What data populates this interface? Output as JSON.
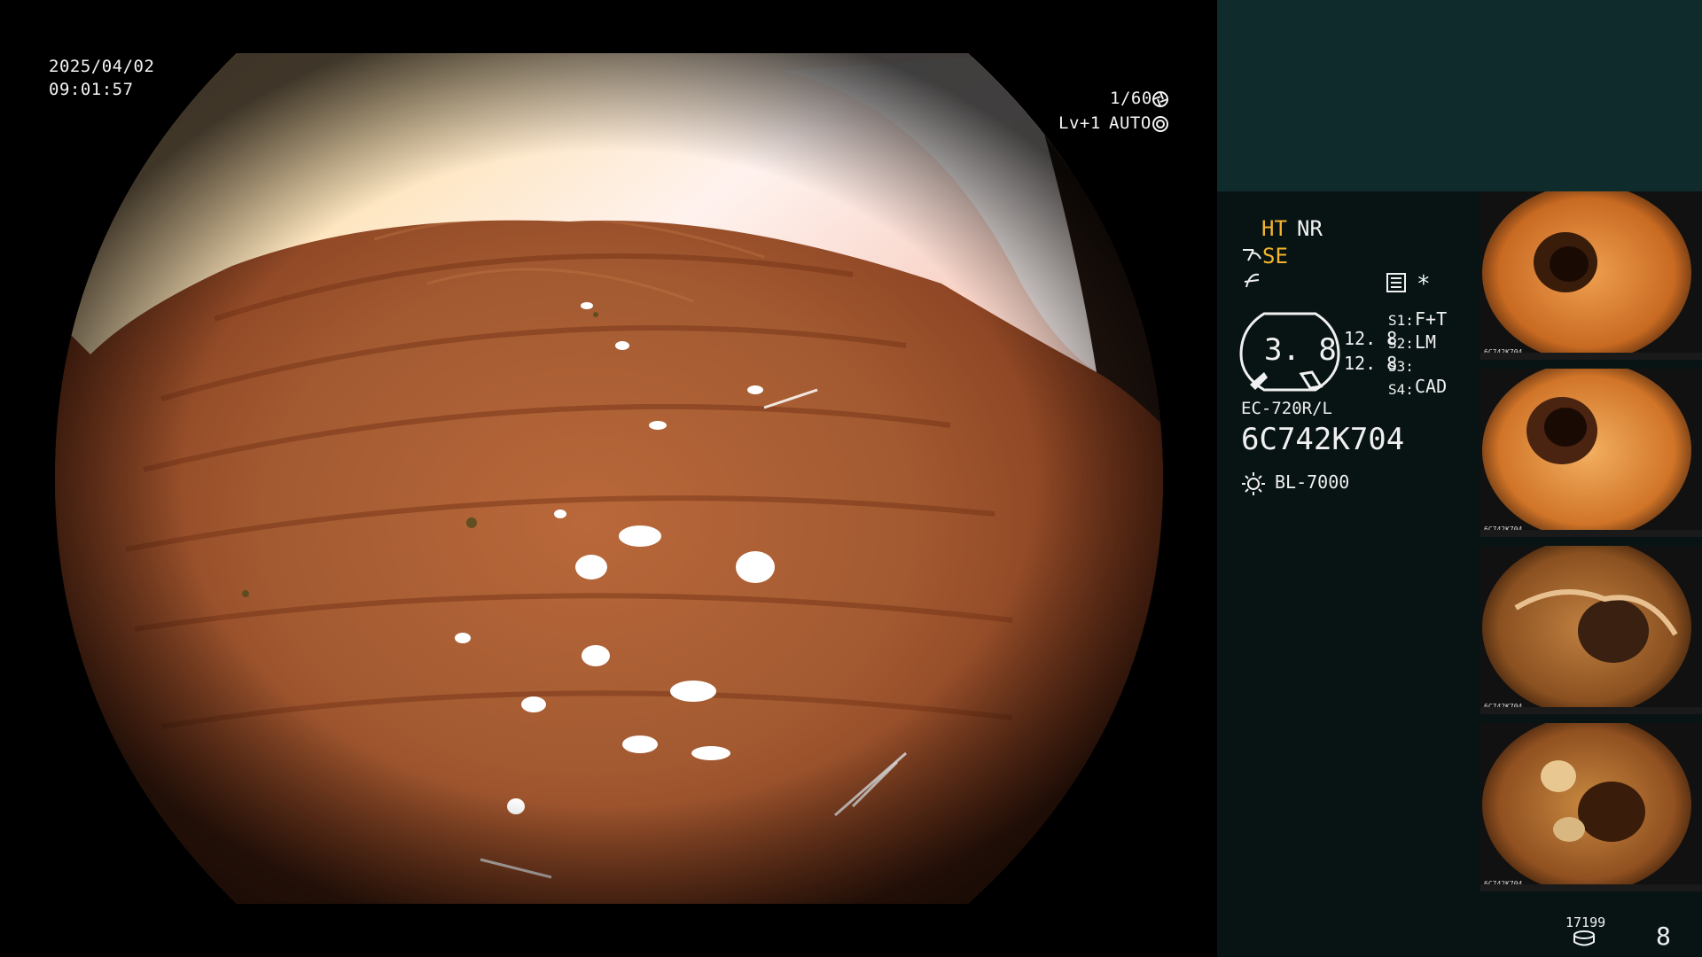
{
  "osd": {
    "date": "2025/04/02",
    "time": "09:01:57",
    "shutter": "1/60",
    "shutter_icon": "aperture-icon",
    "level": "Lv+1",
    "mode": "AUTO",
    "mode_icon": "auto-iris-icon"
  },
  "panel": {
    "ht": "HT",
    "nr": "NR",
    "se": "SE",
    "se_icon": "structure-enhance-icon",
    "freeze_icon": "freeze-curve-icon",
    "menu_icon": "settings-list-icon",
    "asterisk": "*",
    "gauge_value": "3. 8",
    "gauge_top": "12. 8",
    "gauge_bottom": "12. 8",
    "s1_key": "S1:",
    "s1_val": "F+T",
    "s2_key": "S2:",
    "s2_val": "LM",
    "s3_key": "S3:",
    "s3_val": "",
    "s4_key": "S4:",
    "s4_val": "CAD",
    "scope_model": "EC-720R/L",
    "scope_serial": "6C742K704",
    "light_icon": "light-source-icon",
    "light_source": "BL-7000",
    "record_count": "17199",
    "storage_icon": "storage-icon",
    "image_count": "8"
  },
  "thumbnails": [
    {
      "name": "captured-image-1",
      "caption": "6C742K704"
    },
    {
      "name": "captured-image-2",
      "caption": "6C742K704"
    },
    {
      "name": "captured-image-3",
      "caption": "6C742K704"
    },
    {
      "name": "captured-image-4",
      "caption": "6C742K704"
    }
  ],
  "colors": {
    "accent": "#f3b42c",
    "panel_top": "#0f2b2b",
    "panel": "#081414",
    "tissue": "#a85a2e"
  }
}
